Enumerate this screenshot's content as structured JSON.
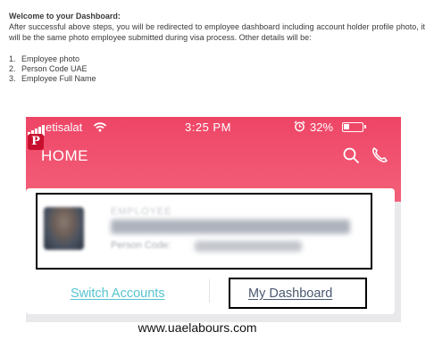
{
  "document": {
    "title": "Welcome to your Dashboard:",
    "paragraph": "After successful above steps, you will be redirected to employee dashboard including account holder profile photo, it will be the same photo employee submitted during visa process. Other details will be:",
    "list": [
      {
        "num": "1.",
        "text": "Employee photo"
      },
      {
        "num": "2.",
        "text": "Person Code UAE"
      },
      {
        "num": "3.",
        "text": "Employee Full Name"
      }
    ]
  },
  "status_bar": {
    "carrier": "etisalat",
    "time": "3:25 PM",
    "battery": "32%",
    "battery_level": 0.32,
    "icons": [
      "signal-icon",
      "wifi-icon",
      "alarm-icon",
      "battery-icon"
    ]
  },
  "app_header": {
    "title": "HOME",
    "pinterest_badge": "P",
    "background_color": "#ef4a69",
    "icons": [
      "search-icon",
      "phone-icon"
    ]
  },
  "profile_card": {
    "label": "EMPLOYEE",
    "code_label": "Person Code:"
  },
  "actions": {
    "switch_accounts": "Switch Accounts",
    "my_dashboard": "My Dashboard",
    "switch_color": "#56c4cf"
  },
  "watermark": "www.uaelabours.com"
}
